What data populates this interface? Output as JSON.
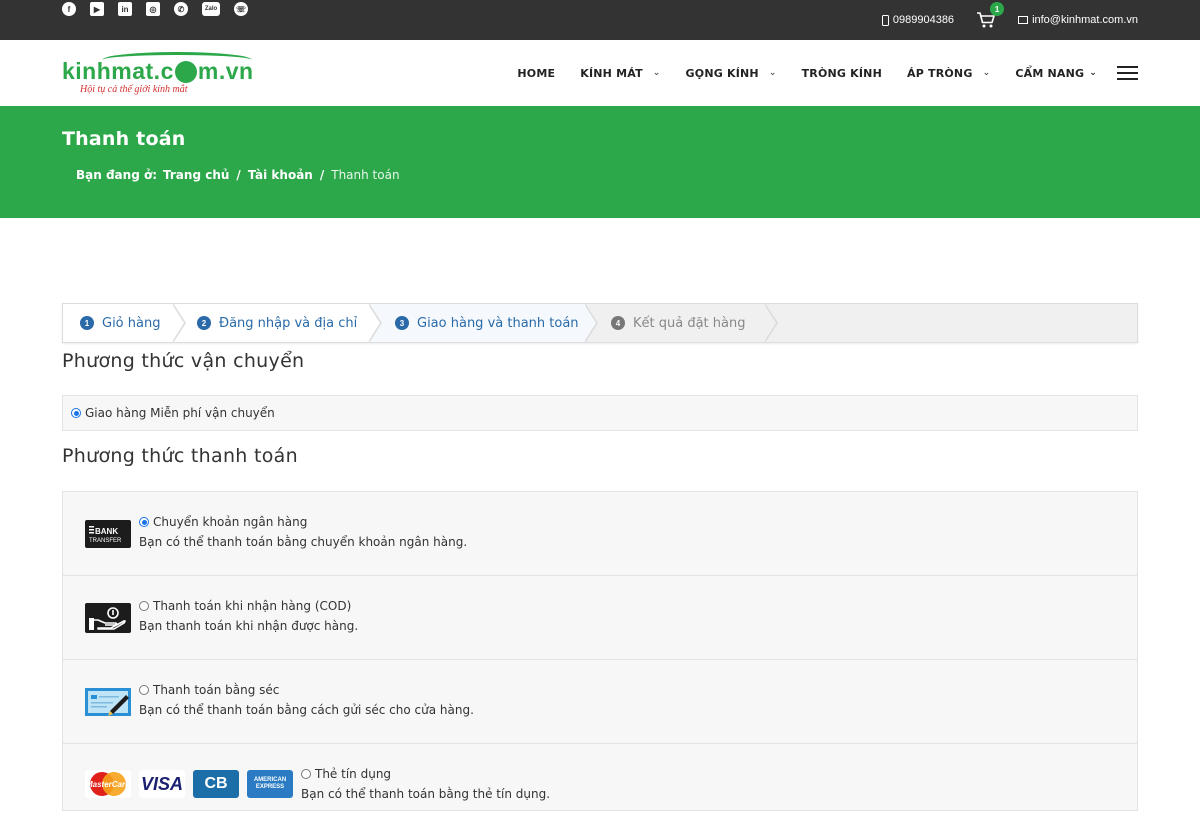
{
  "topbar": {
    "social_icons": [
      "facebook-icon",
      "youtube-icon",
      "linkedin-icon",
      "instagram-icon",
      "whatsapp-icon",
      "zalo-icon",
      "viber-icon"
    ],
    "zalo_label": "Zalo",
    "phone": "0989904386",
    "cart_count": "1",
    "email": "info@kinhmat.com.vn"
  },
  "header": {
    "logo_text_a": "kinhmat.c",
    "logo_text_b": "m.vn",
    "logo_tagline": "Hội tụ cả thế giới kính mắt",
    "nav": [
      {
        "label": "HOME"
      },
      {
        "label": "KÍNH MÁT"
      },
      {
        "label": "GỌNG KÍNH"
      },
      {
        "label": "TRÒNG KÍNH"
      },
      {
        "label": "ÁP TRÒNG"
      },
      {
        "label": "CẨM NANG"
      }
    ]
  },
  "banner": {
    "title": "Thanh toán",
    "breadcrumb_prefix": "Bạn đang ở:",
    "crumbs": [
      "Trang chủ",
      "Tài khoản",
      "Thanh toán"
    ],
    "sep": "/"
  },
  "steps": [
    {
      "num": "1",
      "label": "Giỏ hàng"
    },
    {
      "num": "2",
      "label": "Đăng nhập và địa chỉ"
    },
    {
      "num": "3",
      "label": "Giao hàng và thanh toán"
    },
    {
      "num": "4",
      "label": "Kết quả đặt hàng"
    }
  ],
  "shipping": {
    "title": "Phương thức vận chuyển",
    "option": "Giao hàng Miễn phí vận chuyển"
  },
  "payment": {
    "title": "Phương thức thanh toán",
    "methods": [
      {
        "label": "Chuyển khoản ngân hàng",
        "desc": "Bạn có thể thanh toán bằng chuyển khoản ngân hàng.",
        "icon": "bank-transfer-icon",
        "icon_text": "BANK TRANSFER",
        "selected": true
      },
      {
        "label": "Thanh toán khi nhận hàng (COD)",
        "desc": "Bạn thanh toán khi nhận được hàng.",
        "icon": "cash-on-delivery-icon",
        "selected": false
      },
      {
        "label": "Thanh toán bằng séc",
        "desc": "Bạn có thể thanh toán bằng cách gửi séc cho cửa hàng.",
        "icon": "cheque-icon",
        "selected": false
      },
      {
        "label": "Thẻ tín dụng",
        "desc": "Bạn có thể thanh toán bằng thẻ tín dụng.",
        "icon": "credit-cards-icon",
        "selected": false
      }
    ],
    "card_brands": [
      "MasterCard",
      "VISA",
      "CB",
      "AMERICAN EXPRESS"
    ]
  },
  "colors": {
    "brand_green": "#2ca84a",
    "topbar": "#333333",
    "step_blue": "#2a6aa8"
  }
}
